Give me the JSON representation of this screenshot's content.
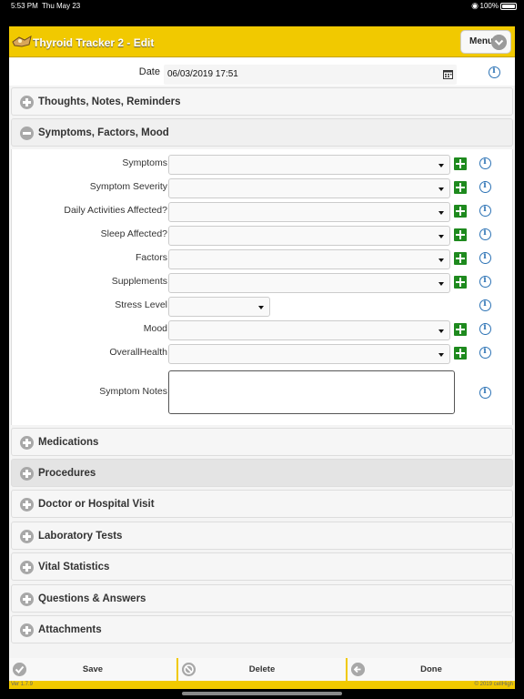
{
  "status": {
    "time": "5:53 PM",
    "date": "Thu May 23",
    "battery": "100%"
  },
  "header": {
    "title": "Thyroid Tracker 2 - Edit",
    "menu_label": "Menu"
  },
  "date_field": {
    "label": "Date",
    "value": "06/03/2019 17:51"
  },
  "sections": {
    "thoughts": "Thoughts, Notes, Reminders",
    "symptoms": "Symptoms, Factors, Mood",
    "medications": "Medications",
    "procedures": "Procedures",
    "doctor": "Doctor or Hospital Visit",
    "labs": "Laboratory Tests",
    "vitals": "Vital Statistics",
    "qa": "Questions & Answers",
    "attachments": "Attachments"
  },
  "fields": {
    "symptoms": "Symptoms",
    "severity": "Symptom Severity",
    "daily": "Daily Activities Affected?",
    "sleep": "Sleep Affected?",
    "factors": "Factors",
    "supplements": "Supplements",
    "stress": "Stress Level",
    "mood": "Mood",
    "overall": "OverallHealth",
    "notes": "Symptom Notes"
  },
  "footer": {
    "save": "Save",
    "delete": "Delete",
    "done": "Done",
    "version": "Ver 1.7.9",
    "copyright": "© 2019 cellHigh"
  },
  "colors": {
    "header_bg": "#f1c900",
    "add_green": "#1e8a1e",
    "info_blue": "#2d73b5"
  }
}
